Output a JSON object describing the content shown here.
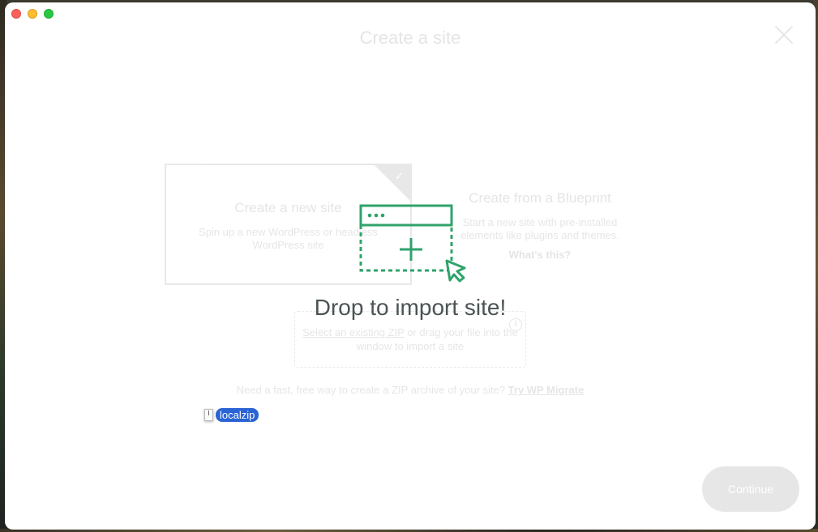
{
  "page": {
    "title": "Create a site"
  },
  "options": {
    "new_site": {
      "title": "Create a new site",
      "description": "Spin up a new WordPress or headless WordPress site"
    },
    "blueprint": {
      "title": "Create from a Blueprint",
      "description": "Start a new site with pre-installed elements like plugins and themes.",
      "link": "What's this?"
    }
  },
  "import": {
    "link_text": "Select an existing ZIP",
    "rest_text": " or drag your file into the window to import a site"
  },
  "footer": {
    "question": "Need a fast, free way to create a ZIP archive of your site? ",
    "link": "Try WP Migrate"
  },
  "buttons": {
    "continue": "Continue"
  },
  "drop_overlay": {
    "title": "Drop to import site!"
  },
  "drag_item": {
    "label": "localzip"
  },
  "colors": {
    "accent_green": "#2fa36b",
    "drag_highlight": "#2a63d4"
  }
}
